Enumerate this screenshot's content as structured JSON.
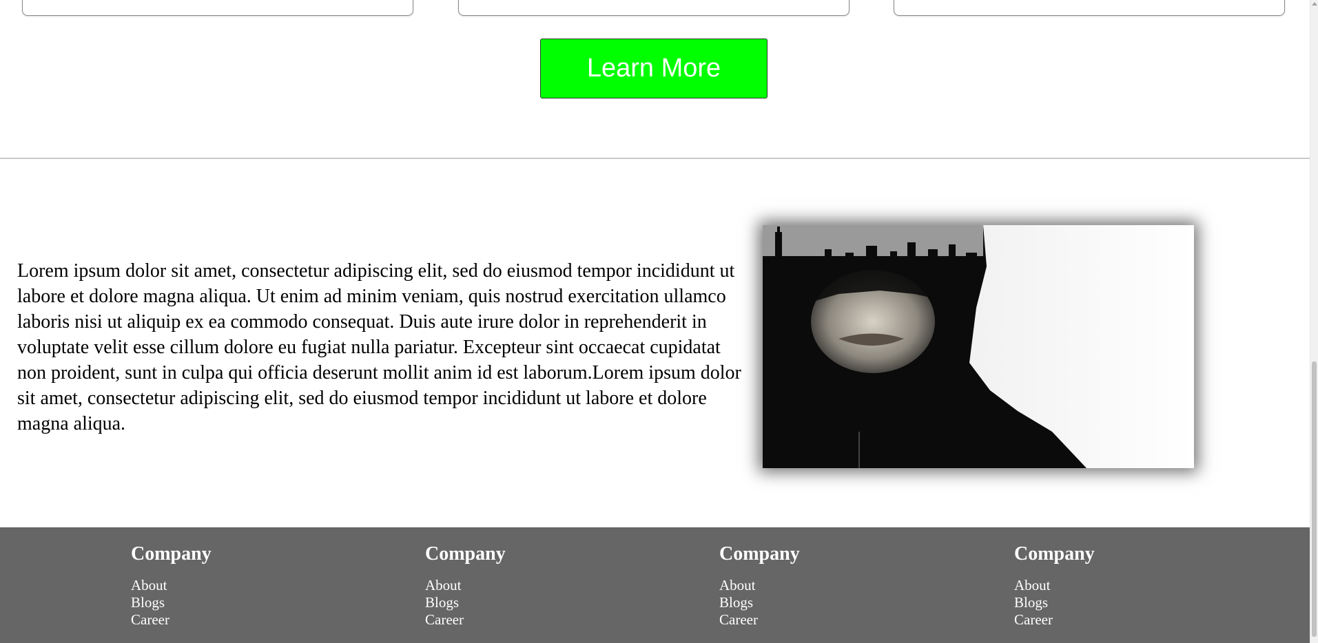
{
  "cta": {
    "learn_more_label": "Learn More",
    "button_color": "#00ff00"
  },
  "about": {
    "paragraph": "Lorem ipsum dolor sit amet, consectetur adipiscing elit, sed do eiusmod tempor incididunt ut labore et dolore magna aliqua. Ut enim ad minim veniam, quis nostrud exercitation ullamco laboris nisi ut aliquip ex ea commodo consequat. Duis aute irure dolor in reprehenderit in voluptate velit esse cillum dolore eu fugiat nulla pariatur. Excepteur sint occaecat cupidatat non proident, sunt in culpa qui officia deserunt mollit anim id est laborum.Lorem ipsum dolor sit amet, consectetur adipiscing elit, sed do eiusmod tempor incididunt ut labore et dolore magna aliqua."
  },
  "footer": {
    "background": "#666666",
    "columns": [
      {
        "heading": "Company",
        "links": [
          "About",
          "Blogs",
          "Career"
        ]
      },
      {
        "heading": "Company",
        "links": [
          "About",
          "Blogs",
          "Career"
        ]
      },
      {
        "heading": "Company",
        "links": [
          "About",
          "Blogs",
          "Career"
        ]
      },
      {
        "heading": "Company",
        "links": [
          "About",
          "Blogs",
          "Career"
        ]
      }
    ]
  }
}
